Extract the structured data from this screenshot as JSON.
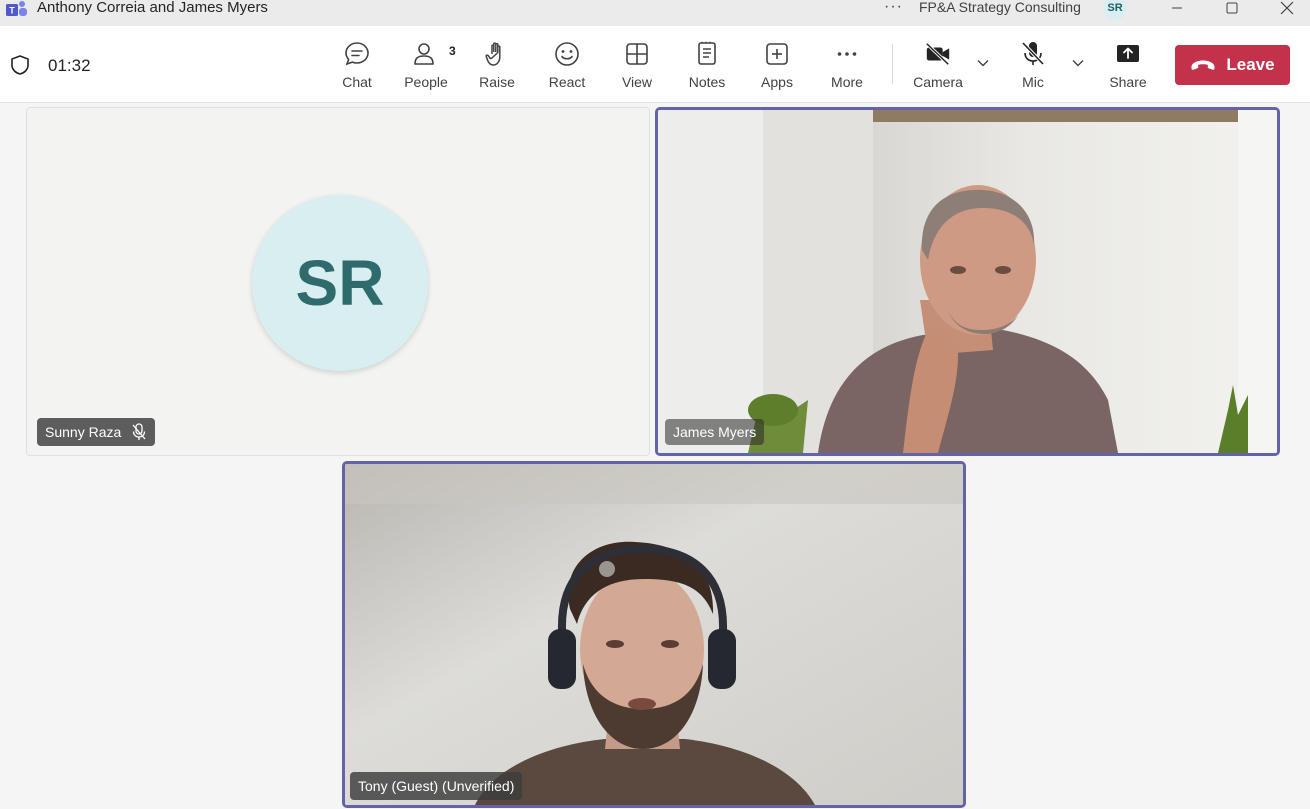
{
  "window": {
    "title": "Anthony Correia and James Myers",
    "org_name": "FP&A Strategy Consulting",
    "user_initials": "SR",
    "dots": "···"
  },
  "toolbar": {
    "timer": "01:32",
    "buttons": [
      {
        "id": "chat",
        "label": "Chat",
        "icon": "chat-icon"
      },
      {
        "id": "people",
        "label": "People",
        "icon": "people-icon",
        "count": "3"
      },
      {
        "id": "raise",
        "label": "Raise",
        "icon": "hand-icon"
      },
      {
        "id": "react",
        "label": "React",
        "icon": "smiley-icon"
      },
      {
        "id": "view",
        "label": "View",
        "icon": "grid-icon"
      },
      {
        "id": "notes",
        "label": "Notes",
        "icon": "notes-icon"
      },
      {
        "id": "apps",
        "label": "Apps",
        "icon": "plus-square-icon"
      },
      {
        "id": "more",
        "label": "More",
        "icon": "ellipsis-icon"
      },
      {
        "id": "camera",
        "label": "Camera",
        "icon": "camera-off-icon"
      },
      {
        "id": "mic",
        "label": "Mic",
        "icon": "mic-off-icon"
      },
      {
        "id": "share",
        "label": "Share",
        "icon": "share-tray-icon"
      }
    ],
    "leave_label": "Leave"
  },
  "participants": [
    {
      "name": "Sunny Raza",
      "initials": "SR",
      "muted": true,
      "video": false
    },
    {
      "name": "James Myers",
      "video": true,
      "active_speaker": true
    },
    {
      "name": "Tony (Guest) (Unverified)",
      "video": true,
      "active_speaker": true
    }
  ],
  "colors": {
    "accent": "#6264a7",
    "leave": "#c4314b",
    "avatar_bg": "#d8eef0",
    "avatar_text": "#2f6b6c"
  }
}
